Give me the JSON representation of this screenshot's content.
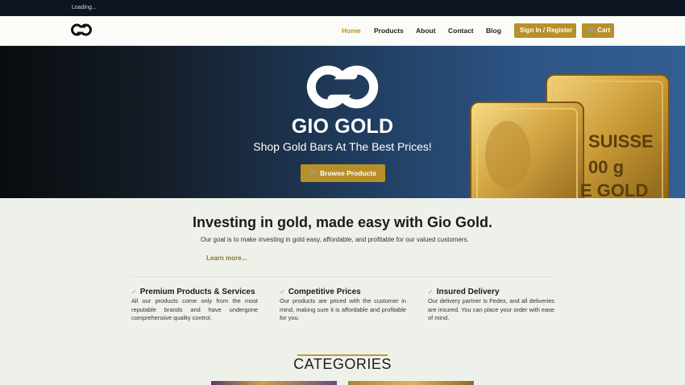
{
  "topbar": {
    "loading": "Loading..."
  },
  "brand": {
    "accent": "#b8902a",
    "dark": "#0c1521"
  },
  "nav": {
    "links": [
      "Home",
      "Products",
      "About",
      "Contact",
      "Blog"
    ],
    "sign_in": "Sign In / Register",
    "cart": "Cart"
  },
  "hero": {
    "title": "GIO GOLD",
    "subtitle": "Shop Gold Bars At The Best Prices!",
    "button": "Browse Products",
    "bar_back_text": "SUISSE",
    "bar_front_text_1": "00 g",
    "bar_front_text_2": "E GOLD"
  },
  "intro": {
    "heading": "Investing in gold, made easy with Gio Gold.",
    "text": "Our goal is to make investing in gold easy, affordable, and profitable for our valued customers.",
    "learn_more": "Learn more..."
  },
  "features": [
    {
      "title": "Premium Products & Services",
      "body": "All our products come only from the most reputable brands and have undergone comprehensive quality control."
    },
    {
      "title": "Competitive Prices",
      "body": "Our products are priced with the customer in mind, making sure it is affordable and profitable for you."
    },
    {
      "title": "Insured Delivery",
      "body": "Our delivery partner is Fedex, and all deliveries are insured. You can place your order with ease of mind."
    }
  ],
  "categories": {
    "heading": "CATEGORIES"
  }
}
